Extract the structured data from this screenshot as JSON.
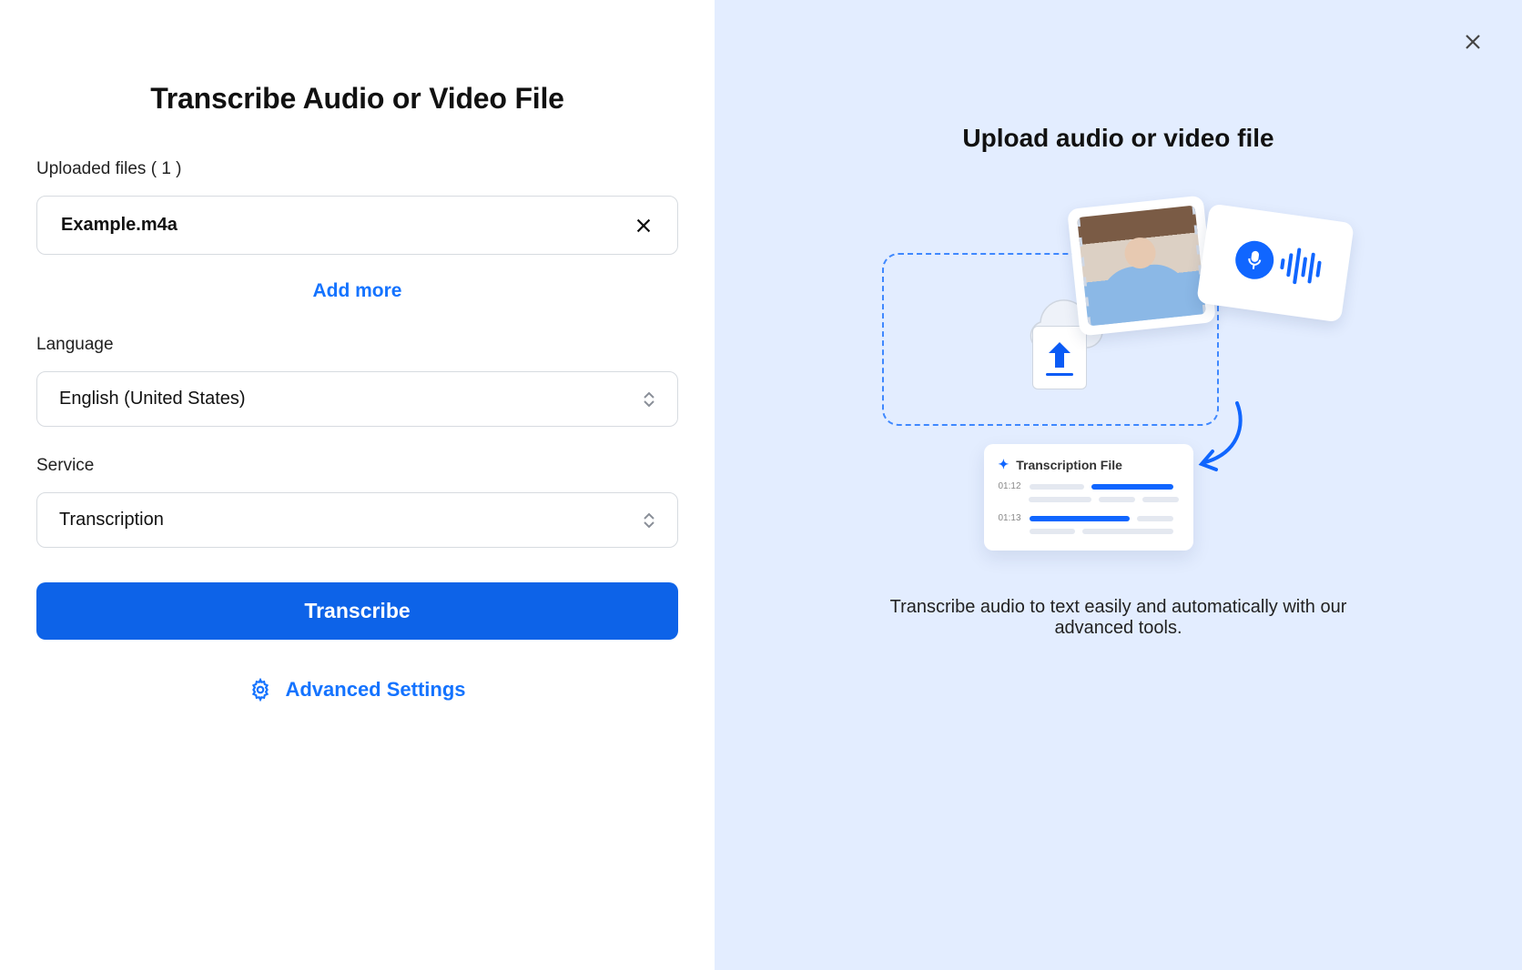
{
  "left": {
    "title": "Transcribe Audio or Video File",
    "uploaded_label_prefix": "Uploaded files",
    "uploaded_count": "1",
    "file_name": "Example.m4a",
    "add_more": "Add more",
    "language_label": "Language",
    "language_value": "English (United States)",
    "service_label": "Service",
    "service_value": "Transcription",
    "transcribe_btn": "Transcribe",
    "advanced_settings": "Advanced Settings"
  },
  "right": {
    "title": "Upload audio or video file",
    "transcription_card_title": "Transcription File",
    "timestamp1": "01:12",
    "timestamp2": "01:13",
    "caption": "Transcribe audio to text easily and automatically with our advanced tools."
  }
}
